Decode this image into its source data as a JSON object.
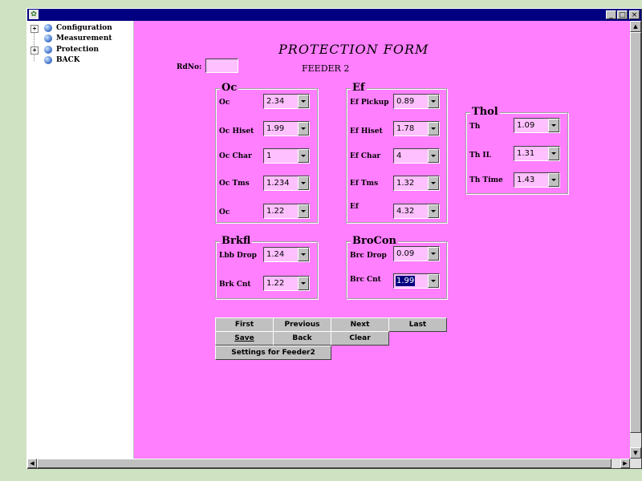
{
  "window": {
    "minimize_glyph": "_",
    "maximize_glyph": "□",
    "close_glyph": "×"
  },
  "tree": {
    "items": [
      {
        "label": "Configuration",
        "expander": "+"
      },
      {
        "label": "Measurement",
        "expander": ""
      },
      {
        "label": "Protection",
        "expander": "+"
      },
      {
        "label": "BACK",
        "expander": ""
      }
    ]
  },
  "form": {
    "title": "PROTECTION    FORM",
    "subtitle": "FEEDER 2",
    "rdno_label": "RdNo:",
    "rdno_value": ""
  },
  "groups": {
    "oc": {
      "title": "Oc",
      "fields": [
        {
          "label": "Oc",
          "value": "2.34"
        },
        {
          "label": "Oc Hiset",
          "value": "1.99"
        },
        {
          "label": "Oc Char",
          "value": "1"
        },
        {
          "label": "Oc Tms",
          "value": "1.234"
        },
        {
          "label": "Oc",
          "value": "1.22"
        }
      ]
    },
    "ef": {
      "title": "Ef",
      "fields": [
        {
          "label": "Ef Pickup",
          "value": "0.89"
        },
        {
          "label": "Ef Hiset",
          "value": "1.78"
        },
        {
          "label": "Ef Char",
          "value": "4"
        },
        {
          "label": "Ef Tms",
          "value": "1.32"
        },
        {
          "label": "Ef",
          "value": "4.32"
        }
      ]
    },
    "thol": {
      "title": "Thol",
      "fields": [
        {
          "label": "Th",
          "value": "1.09"
        },
        {
          "label": "Th IL",
          "value": "1.31"
        },
        {
          "label": "Th Time",
          "value": "1.43"
        }
      ]
    },
    "brkfl": {
      "title": "Brkfl",
      "fields": [
        {
          "label": "Lbb Drop",
          "value": "1.24"
        },
        {
          "label": "Brk Cnt",
          "value": "1.22"
        }
      ]
    },
    "brocon": {
      "title": "BroCon",
      "fields": [
        {
          "label": "Brc Drop",
          "value": "0.09"
        },
        {
          "label": "Brc Cnt",
          "value": "1.99"
        }
      ]
    }
  },
  "buttons": {
    "first": "First",
    "previous": "Previous",
    "next": "Next",
    "last": "Last",
    "save": "Save",
    "back": "Back",
    "clear": "Clear",
    "settings": "Settings for Feeder2"
  },
  "scrollbar": {
    "up": "▲",
    "down": "▼",
    "left": "◀",
    "right": "▶"
  }
}
